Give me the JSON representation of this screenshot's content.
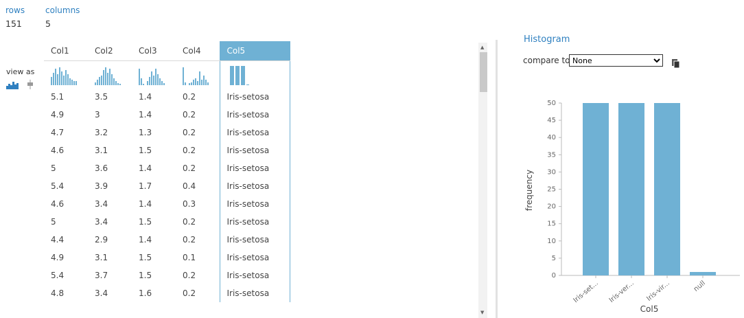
{
  "summary": {
    "rows_label": "rows",
    "rows_value": "151",
    "columns_label": "columns",
    "columns_value": "5"
  },
  "viewas": {
    "label": "view as",
    "icons": [
      "histogram-icon",
      "boxplot-icon"
    ]
  },
  "table": {
    "columns": [
      "Col1",
      "Col2",
      "Col3",
      "Col4",
      "Col5"
    ],
    "selected_column": "Col5",
    "rows": [
      [
        "5.1",
        "3.5",
        "1.4",
        "0.2",
        "Iris-setosa"
      ],
      [
        "4.9",
        "3",
        "1.4",
        "0.2",
        "Iris-setosa"
      ],
      [
        "4.7",
        "3.2",
        "1.3",
        "0.2",
        "Iris-setosa"
      ],
      [
        "4.6",
        "3.1",
        "1.5",
        "0.2",
        "Iris-setosa"
      ],
      [
        "5",
        "3.6",
        "1.4",
        "0.2",
        "Iris-setosa"
      ],
      [
        "5.4",
        "3.9",
        "1.7",
        "0.4",
        "Iris-setosa"
      ],
      [
        "4.6",
        "3.4",
        "1.4",
        "0.3",
        "Iris-setosa"
      ],
      [
        "5",
        "3.4",
        "1.5",
        "0.2",
        "Iris-setosa"
      ],
      [
        "4.4",
        "2.9",
        "1.4",
        "0.2",
        "Iris-setosa"
      ],
      [
        "4.9",
        "3.1",
        "1.5",
        "0.1",
        "Iris-setosa"
      ],
      [
        "5.4",
        "3.7",
        "1.5",
        "0.2",
        "Iris-setosa"
      ],
      [
        "4.8",
        "3.4",
        "1.6",
        "0.2",
        "Iris-setosa"
      ]
    ]
  },
  "panel": {
    "title": "Histogram",
    "compare_label": "compare to",
    "compare_value": "None"
  },
  "colors": {
    "accent": "#6fb1d4",
    "link": "#2f80c0"
  },
  "chart_data": {
    "type": "bar",
    "categories": [
      "Iris-set...",
      "Iris-ver...",
      "Iris-vir...",
      "null"
    ],
    "values": [
      50,
      50,
      50,
      1
    ],
    "xlabel": "Col5",
    "ylabel": "frequency",
    "ylim": [
      0,
      50
    ],
    "yticks": [
      0,
      5,
      10,
      15,
      20,
      25,
      30,
      35,
      40,
      45,
      50
    ],
    "grid": false
  }
}
